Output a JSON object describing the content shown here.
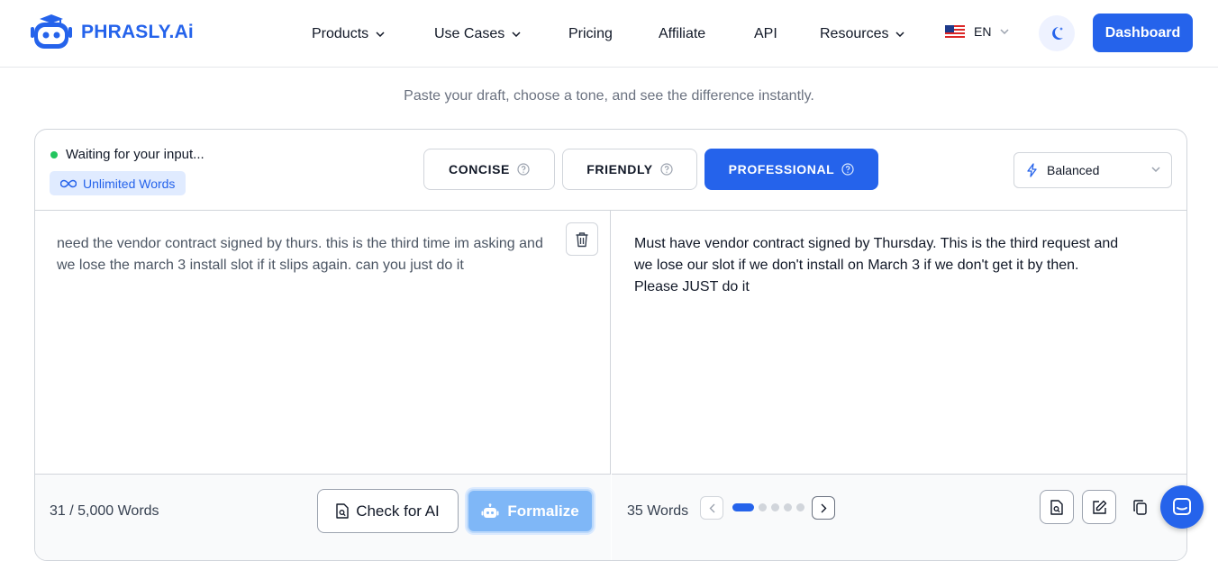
{
  "header": {
    "brand": "PHRASLY.Ai",
    "nav": [
      {
        "label": "Products",
        "dropdown": true
      },
      {
        "label": "Use Cases",
        "dropdown": true
      },
      {
        "label": "Pricing",
        "dropdown": false
      },
      {
        "label": "Affiliate",
        "dropdown": false
      },
      {
        "label": "API",
        "dropdown": false
      },
      {
        "label": "Resources",
        "dropdown": true
      }
    ],
    "language": "EN",
    "dashboard_label": "Dashboard"
  },
  "subtitle": "Paste your draft, choose a tone, and see the difference instantly.",
  "toolbar": {
    "status": "Waiting for your input...",
    "badge": "Unlimited Words",
    "tones": [
      {
        "label": "CONCISE",
        "active": false
      },
      {
        "label": "FRIENDLY",
        "active": false
      },
      {
        "label": "PROFESSIONAL",
        "active": true
      }
    ],
    "mode": "Balanced"
  },
  "input": {
    "text": "need the vendor contract signed by thurs. this is the third time im asking and we lose the march 3 install slot if it slips again. can you just do it",
    "word_count": "31 / 5,000 Words",
    "check_label": "Check for AI",
    "formalize_label": "Formalize"
  },
  "output": {
    "text_lines": [
      "Must have vendor contract signed by Thursday.  This is the third request and",
      "we lose our slot if we don't install on March 3 if we don't get it by then.",
      "Please JUST do it"
    ],
    "word_count": "35 Words",
    "pagination": {
      "total": 5,
      "current": 1
    }
  },
  "colors": {
    "accent": "#2563eb",
    "status_dot": "#22c55e",
    "formalize_disabled": "#7fb7f7"
  }
}
